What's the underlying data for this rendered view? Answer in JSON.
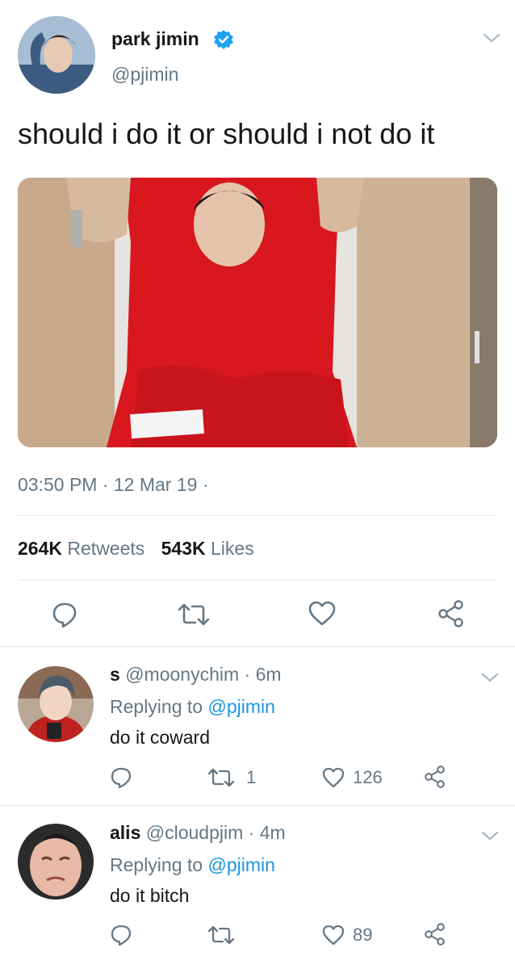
{
  "tweet": {
    "display_name": "park jimin",
    "handle": "@pjimin",
    "verified": true,
    "text": "should i do it or should i not do it",
    "timestamp": "03:50 PM · 12 Mar 19 ·",
    "retweets_count": "264K",
    "retweets_label": "Retweets",
    "likes_count": "543K",
    "likes_label": "Likes"
  },
  "replies": [
    {
      "name": "s",
      "handle": "@moonychim",
      "time": "· 6m",
      "replying_label": "Replying to",
      "replying_handle": "@pjimin",
      "text": "do it coward",
      "retweet_count": "1",
      "like_count": "126"
    },
    {
      "name": "alis",
      "handle": "@cloudpjim",
      "time": "· 4m",
      "replying_label": "Replying to",
      "replying_handle": "@pjimin",
      "text": "do it bitch",
      "retweet_count": "",
      "like_count": "89"
    }
  ],
  "colors": {
    "verified": "#1da1f2",
    "link": "#1b95e0",
    "muted": "#657786",
    "divider": "#e1e8ed"
  },
  "icons": [
    "chevron-down-icon",
    "verified-badge-icon",
    "reply-icon",
    "retweet-icon",
    "like-icon",
    "share-icon"
  ]
}
